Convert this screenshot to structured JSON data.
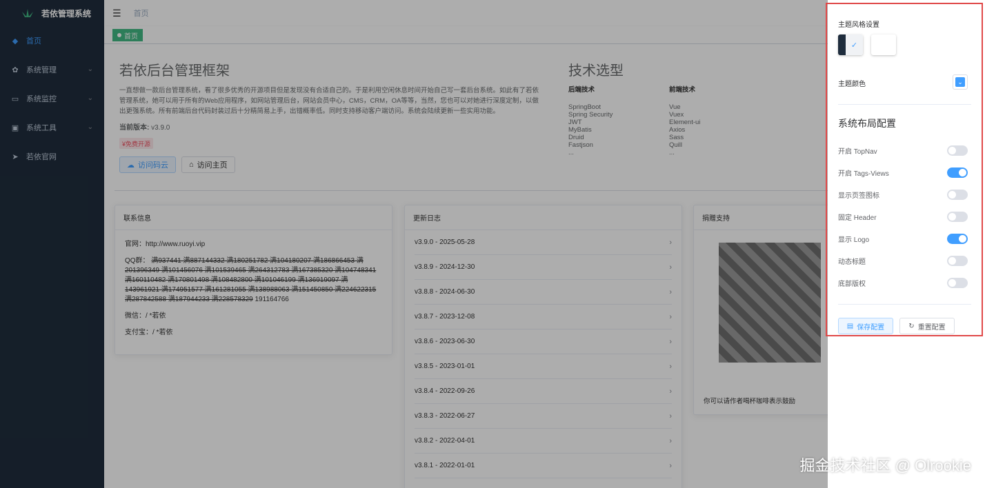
{
  "sidebar": {
    "title": "若依管理系统",
    "items": [
      {
        "label": "首页",
        "icon": "dashboard-icon"
      },
      {
        "label": "系统管理",
        "icon": "system-icon"
      },
      {
        "label": "系统监控",
        "icon": "monitor-icon"
      },
      {
        "label": "系统工具",
        "icon": "tool-icon"
      },
      {
        "label": "若依官网",
        "icon": "send-icon"
      }
    ]
  },
  "navbar": {
    "breadcrumb": "首页"
  },
  "tags": {
    "active": "首页"
  },
  "intro": {
    "title": "若依后台管理框架",
    "desc": "一直想做一款后台管理系统，看了很多优秀的开源项目但是发现没有合适自己的。于是利用空闲休息时间开始自己写一套后台系统。如此有了若依管理系统，她可以用于所有的Web应用程序，如网站管理后台，网站会员中心，CMS，CRM，OA等等，当然，您也可以对她进行深度定制，以做出更强系统。所有前端后台代码封装过后十分精简易上手，出错概率低。同时支持移动客户端访问。系统会陆续更新一些实用功能。",
    "version_label": "当前版本:",
    "version": "v3.9.0",
    "badge": "¥免费开源",
    "btn_gitee": "访问码云",
    "btn_home": "访问主页"
  },
  "tech": {
    "title": "技术选型",
    "backend_title": "后端技术",
    "backend": [
      "SpringBoot",
      "Spring Security",
      "JWT",
      "MyBatis",
      "Druid",
      "Fastjson",
      "..."
    ],
    "frontend_title": "前端技术",
    "frontend": [
      "Vue",
      "Vuex",
      "Element-ui",
      "Axios",
      "Sass",
      "Quill",
      "..."
    ]
  },
  "contact": {
    "title": "联系信息",
    "site": "官网：http://www.ruoyi.vip",
    "qq_label": "QQ群：",
    "qq_groups": "满937441 满887144332 满180251782 满104180207 满186866453 满201396349 满101456076 满101539465 满264312783 满167385320 满104748341 满160110482 满170801498 满108482800 满101046199 满136919097 满143961921 满174951577 满161281055 满138988063 满151450850 满224622315 满287842588 满187944233 满228578329",
    "qq_open": "191164766",
    "wechat": "微信：/ *若依",
    "alipay": "支付宝：/ *若依"
  },
  "changelog": {
    "title": "更新日志",
    "items": [
      "v3.9.0 - 2025-05-28",
      "v3.8.9 - 2024-12-30",
      "v3.8.8 - 2024-06-30",
      "v3.8.7 - 2023-12-08",
      "v3.8.6 - 2023-06-30",
      "v3.8.5 - 2023-01-01",
      "v3.8.4 - 2022-09-26",
      "v3.8.3 - 2022-06-27",
      "v3.8.2 - 2022-04-01",
      "v3.8.1 - 2022-01-01"
    ]
  },
  "donate": {
    "title": "捐赠支持",
    "caption": "你可以请作者喝杯咖啡表示鼓励"
  },
  "settings": {
    "theme_title": "主题风格设置",
    "color_title": "主题颜色",
    "theme_color": "#409eff",
    "layout_title": "系统布局配置",
    "options": [
      {
        "label": "开启 TopNav",
        "on": false
      },
      {
        "label": "开启 Tags-Views",
        "on": true
      },
      {
        "label": "显示页签图标",
        "on": false
      },
      {
        "label": "固定 Header",
        "on": false
      },
      {
        "label": "显示 Logo",
        "on": true
      },
      {
        "label": "动态标题",
        "on": false
      },
      {
        "label": "底部版权",
        "on": false
      }
    ],
    "save_label": "保存配置",
    "reset_label": "重置配置"
  },
  "watermark": "掘金技术社区 @ Olrookie"
}
